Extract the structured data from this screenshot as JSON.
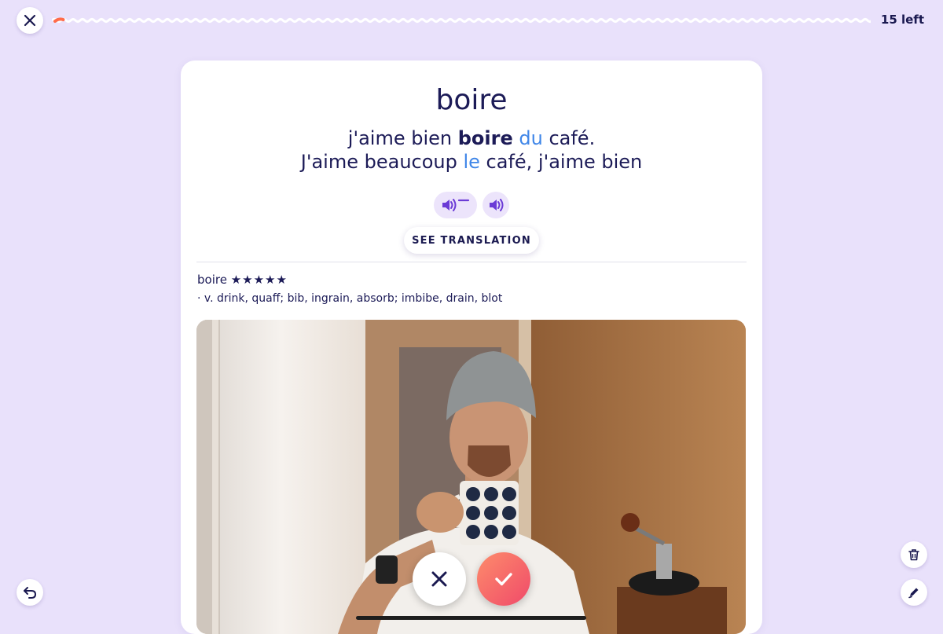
{
  "topbar": {
    "close_icon": "close-icon",
    "progress_fraction": 0.01,
    "remaining_label": "15 left"
  },
  "card": {
    "word": "boire",
    "sentence": {
      "line1": [
        {
          "text": "j'aime bien ",
          "style": "normal"
        },
        {
          "text": "boire",
          "style": "bold"
        },
        {
          "text": " ",
          "style": "normal"
        },
        {
          "text": "du",
          "style": "highlight"
        },
        {
          "text": " café.",
          "style": "normal"
        }
      ],
      "line2": [
        {
          "text": "J'aime beaucoup ",
          "style": "normal"
        },
        {
          "text": "le",
          "style": "highlight"
        },
        {
          "text": " café, j'aime bien",
          "style": "normal"
        }
      ]
    },
    "audio": {
      "slow_icon": "speaker-slow-icon",
      "normal_icon": "speaker-icon"
    },
    "see_translation_label": "SEE TRANSLATION",
    "dictionary": {
      "headword": "boire",
      "stars": "★★★★★",
      "definition": "· v. drink, quaff; bib, ingrain, absorb; imbibe, drain, blot"
    },
    "media": "video-frame"
  },
  "actions": {
    "wrong_icon": "x-icon",
    "right_icon": "check-icon",
    "undo_icon": "undo-icon",
    "delete_icon": "trash-icon",
    "edit_icon": "pencil-icon"
  },
  "colors": {
    "background": "#e9e1fb",
    "text": "#1c1b57",
    "highlight": "#3f86e8",
    "accent_purple": "#6b3bd6",
    "progress": "#ff6b4a",
    "right_gradient_start": "#fd8c6b",
    "right_gradient_end": "#f04a6a"
  }
}
